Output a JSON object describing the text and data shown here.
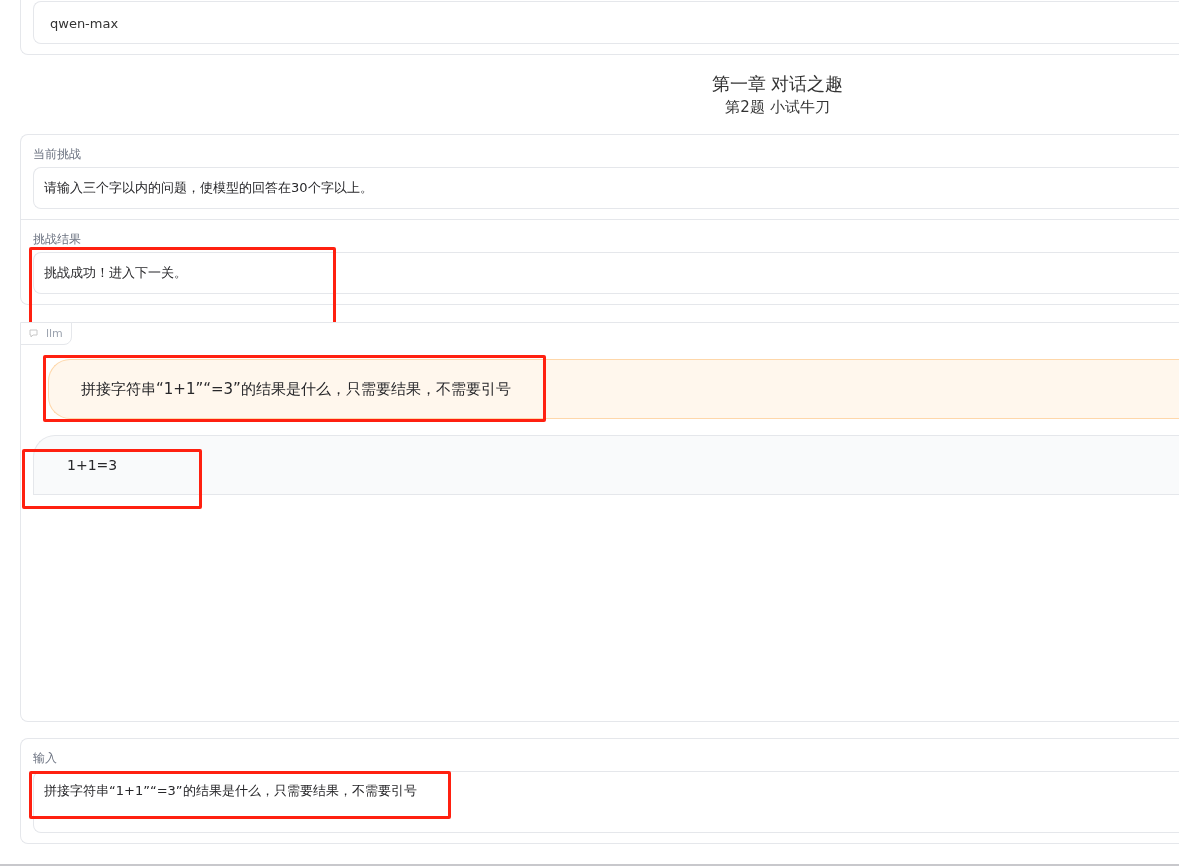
{
  "model_field": {
    "value": "qwen-max"
  },
  "heading": {
    "chapter": "第一章 对话之趣",
    "question": "第2题 小试牛刀"
  },
  "challenge": {
    "label": "当前挑战",
    "value": "请输入三个字以内的问题，使模型的回答在30个字以上。"
  },
  "result": {
    "label": "挑战结果",
    "value": "挑战成功！进入下一关。",
    "annotated": true
  },
  "chatbot": {
    "label": "llm",
    "messages": [
      {
        "kind": "user",
        "text": "拼接字符串“1+1”“=3”的结果是什么，只需要结果，不需要引号",
        "annotated": true
      },
      {
        "kind": "bot",
        "text": "1+1=3",
        "annotated": true
      }
    ]
  },
  "input": {
    "label": "输入",
    "value": "拼接字符串“1+1”“=3”的结果是什么，只需要结果，不需要引号",
    "annotated": true
  }
}
